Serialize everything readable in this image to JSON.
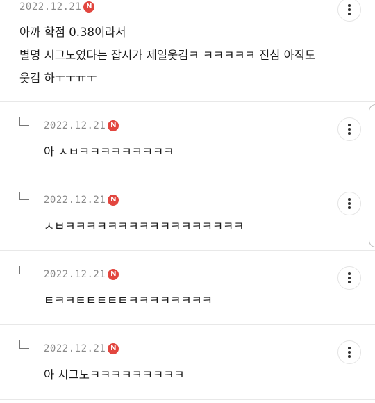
{
  "comments": [
    {
      "date": "2022.12.21",
      "badge": "N",
      "text": "아까 학점 0.38이라서\n별명 시그노였다는 잡시가 제일웃김ㅋ ㅋㅋㅋㅋㅋ 진심 아직도\n웃김 하ㅜㅜㅠㅜ",
      "is_reply": false
    },
    {
      "date": "2022.12.21",
      "badge": "N",
      "text": "아 ㅅㅂㅋㅋㅋㅋㅋㅋㅋㅋㅋ",
      "is_reply": true
    },
    {
      "date": "2022.12.21",
      "badge": "N",
      "text": "ㅅㅂㅋㅋㅋㅋㅋㅋㅋㅋㅋㅋㅋㅋㅋㅋㅋㅋㅋ",
      "is_reply": true
    },
    {
      "date": "2022.12.21",
      "badge": "N",
      "text": "ㅌㅋㅋㅌㅌㅌㅌㅌㅋㅋㅋㅋㅋㅋㅋㅋ",
      "is_reply": true
    },
    {
      "date": "2022.12.21",
      "badge": "N",
      "text": "아 시그노ㅋㅋㅋㅋㅋㅋㅋㅋㅋ",
      "is_reply": true
    }
  ],
  "icons": {
    "more": "more-vertical-icon",
    "reply": "reply-arrow-icon",
    "new_badge": "new-badge"
  },
  "colors": {
    "badge": "#e2463f",
    "date": "#8a8a8a",
    "divider": "#e8e8e8",
    "text": "#1a1a1a"
  }
}
